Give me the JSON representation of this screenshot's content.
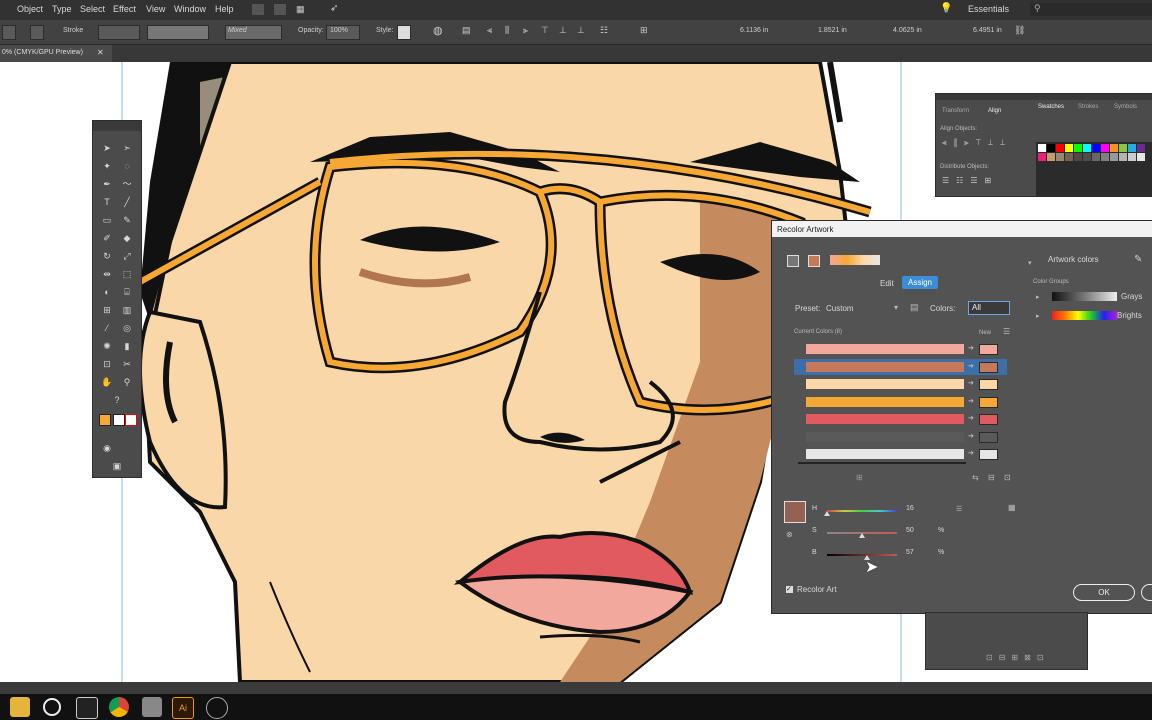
{
  "menubar": {
    "items": [
      "Object",
      "Type",
      "Select",
      "Effect",
      "View",
      "Window",
      "Help"
    ],
    "workspace": "Essentials"
  },
  "controlbar": {
    "stroke_label": "Stroke",
    "blend_mode": "Mixed",
    "opacity_label": "Opacity:",
    "opacity_value": "100%",
    "style_label": "Style:",
    "x_value": "6.1136 in",
    "y_value": "1.8521 in",
    "w_value": "4.0625 in",
    "h_value": "6.4951 in"
  },
  "document": {
    "tab_label": "0% (CMYK/GPU Preview)"
  },
  "align_panel": {
    "tabs": [
      "Transform",
      "Align",
      "Swatches",
      "Strokes",
      "Symbols"
    ],
    "align_objects_label": "Align Objects:",
    "distribute_objects_label": "Distribute Objects:",
    "swatch_colors": [
      "#ffffff",
      "#000000",
      "#ff0000",
      "#ffff00",
      "#00ff00",
      "#00ffff",
      "#0000ff",
      "#ff00ff",
      "#f7931e",
      "#8cc63f",
      "#29abe2",
      "#662d91",
      "#ed1e79",
      "#c69c6d",
      "#998675",
      "#736357",
      "#534741",
      "#4d4d4d",
      "#666666",
      "#808080",
      "#999999",
      "#b3b3b3",
      "#cccccc",
      "#e6e6e6"
    ]
  },
  "recolor": {
    "title": "Recolor Artwork",
    "artwork_colors_label": "Artwork colors",
    "tab_edit": "Edit",
    "tab_assign": "Assign",
    "preset_label": "Preset:",
    "preset_value": "Custom",
    "colors_label": "Colors:",
    "colors_value": "All",
    "current_colors_label": "Current Colors (8)",
    "new_label": "New",
    "color_groups_label": "Color Groups",
    "groups": [
      {
        "name": "Grays"
      },
      {
        "name": "Brights"
      }
    ],
    "rows": [
      {
        "color": "#f2a89c"
      },
      {
        "color": "#c4795a"
      },
      {
        "color": "#fad7a8"
      },
      {
        "color": "#f7a733"
      },
      {
        "color": "#e05a60"
      },
      {
        "color": "#5a5a5a"
      },
      {
        "color": "#e6e6e6"
      }
    ],
    "hsb": {
      "h_label": "H",
      "h_value": "16",
      "s_label": "S",
      "s_value": "50",
      "s_unit": "%",
      "b_label": "B",
      "b_value": "57",
      "b_unit": "%"
    },
    "selected_color": "#946152",
    "recolor_art_label": "Recolor Art",
    "ok_label": "OK"
  },
  "taskbar": {
    "icons": [
      "file-explorer-icon",
      "obs-icon",
      "photos-icon",
      "chrome-icon",
      "store-icon",
      "illustrator-icon",
      "settings-icon"
    ]
  }
}
